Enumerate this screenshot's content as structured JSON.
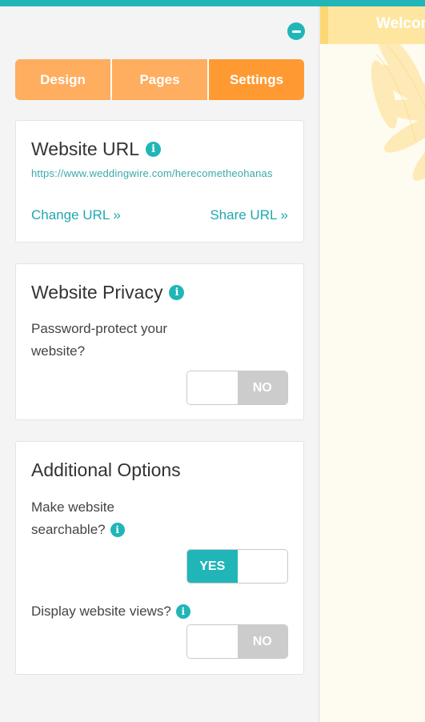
{
  "tabs": {
    "design": "Design",
    "pages": "Pages",
    "settings": "Settings"
  },
  "website_url": {
    "title": "Website URL",
    "url": "https://www.weddingwire.com/herecometheohanas",
    "change_link": "Change URL »",
    "share_link": "Share URL »"
  },
  "privacy": {
    "title": "Website Privacy",
    "question_line1": "Password-protect your",
    "question_line2": "website?",
    "toggle_value": "NO"
  },
  "additional": {
    "title": "Additional Options",
    "searchable_line1": "Make website",
    "searchable_line2": "searchable?",
    "searchable_value": "YES",
    "views_label": "Display website views?",
    "views_value": "NO"
  },
  "preview": {
    "welcome": "Welcome"
  },
  "icons": {
    "info": "info-icon",
    "collapse": "minus-circle-icon"
  },
  "colors": {
    "accent": "#20b6b8",
    "tab": "#ffad5f",
    "tab_active": "#ff9a33",
    "toggle_off": "#cccccc"
  }
}
